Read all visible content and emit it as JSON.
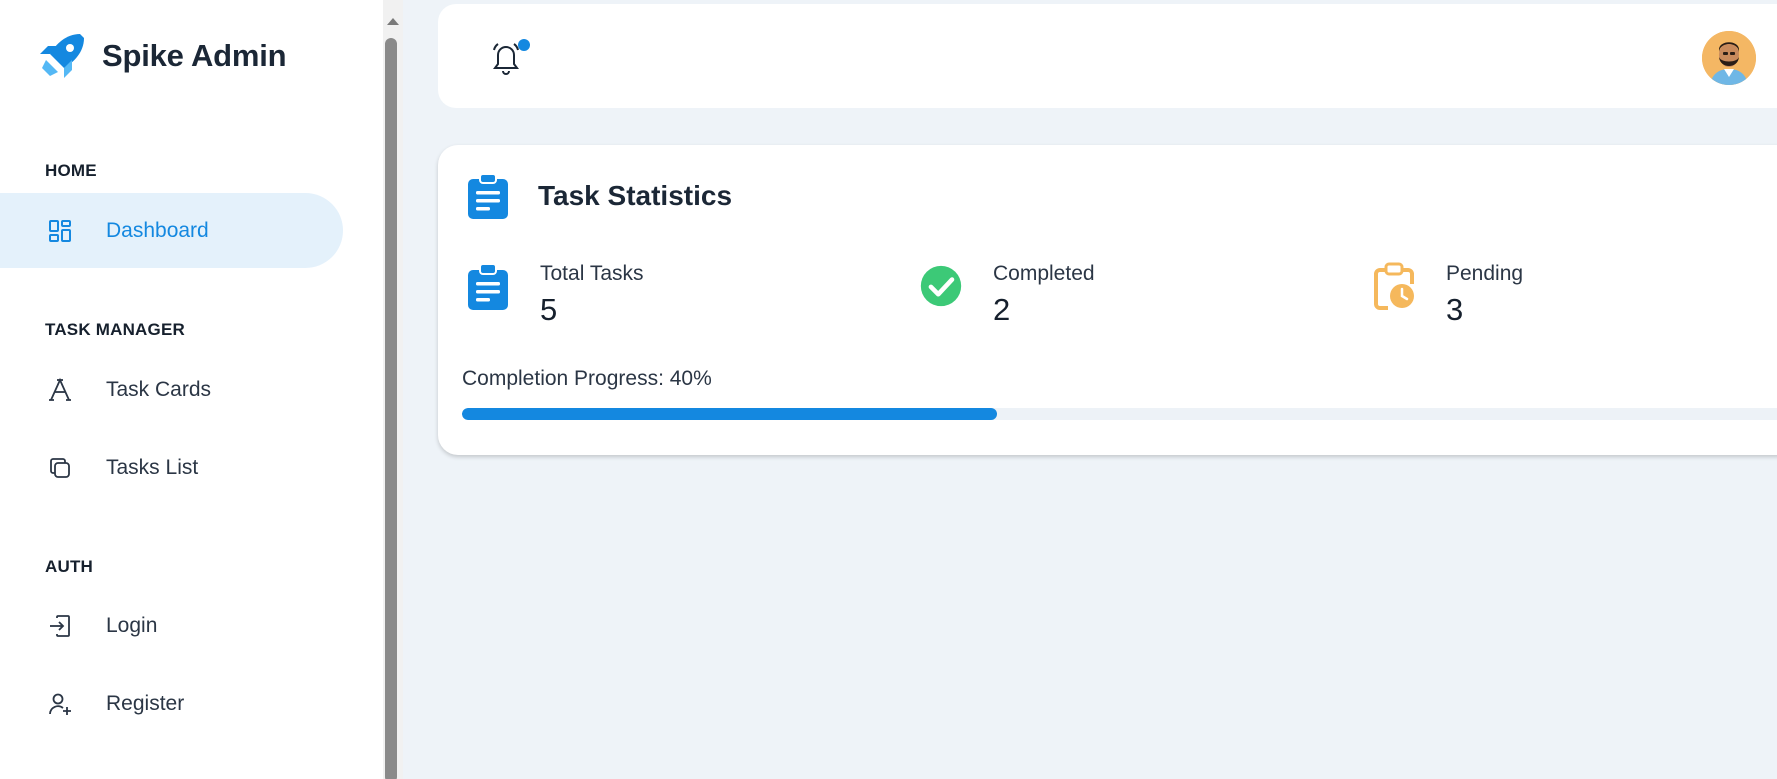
{
  "brand": {
    "name": "Spike Admin"
  },
  "sidebar": {
    "sections": [
      {
        "heading": "HOME"
      },
      {
        "heading": "TASK MANAGER"
      },
      {
        "heading": "AUTH"
      }
    ],
    "items": [
      {
        "label": "Dashboard",
        "icon": "dashboard-icon",
        "active": true
      },
      {
        "label": "Task Cards",
        "icon": "typography-icon"
      },
      {
        "label": "Tasks List",
        "icon": "copy-icon"
      },
      {
        "label": "Login",
        "icon": "login-icon"
      },
      {
        "label": "Register",
        "icon": "user-plus-icon"
      }
    ]
  },
  "header": {
    "notification_icon": "bell-icon",
    "has_unread": true,
    "avatar": "user-avatar"
  },
  "task_statistics": {
    "title": "Task Statistics",
    "stats": [
      {
        "label": "Total Tasks",
        "value": "5",
        "icon": "clipboard-list-icon",
        "color": "#1488e0"
      },
      {
        "label": "Completed",
        "value": "2",
        "icon": "check-circle-icon",
        "color": "#3cc977"
      },
      {
        "label": "Pending",
        "value": "3",
        "icon": "clipboard-clock-icon",
        "color": "#f5b85c"
      }
    ],
    "progress_label": "Completion Progress: 40%",
    "progress_fraction": 0.4
  },
  "colors": {
    "accent": "#1488e0",
    "active_bg": "#e4f1fb",
    "page_bg": "#eef3f8",
    "success": "#3cc977",
    "warning": "#f5b85c"
  }
}
